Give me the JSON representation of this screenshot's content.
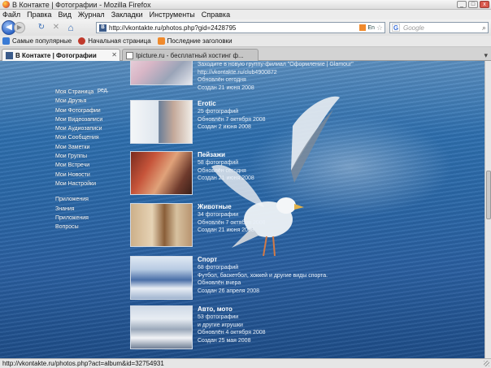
{
  "window": {
    "title": "В Контакте | Фотографии - Mozilla Firefox",
    "min_label": "_",
    "max_label": "□",
    "close_label": "x"
  },
  "menubar": [
    "Файл",
    "Правка",
    "Вид",
    "Журнал",
    "Закладки",
    "Инструменты",
    "Справка"
  ],
  "navbar": {
    "back_glyph": "◀",
    "forward_glyph": "▶",
    "reload_glyph": "↻",
    "stop_glyph": "✕",
    "home_glyph": "⌂",
    "favicon_label": "B",
    "url": "http://vkontakte.ru/photos.php?gid=2428795",
    "lang_label": "En",
    "star_glyph": "☆",
    "search_engine_label": "G",
    "search_placeholder": "Google",
    "search_glyph": "⌕"
  },
  "bookmarks": [
    {
      "label": "Самые популярные",
      "icon": "bookmark-check-icon",
      "color": "#3a7bd5"
    },
    {
      "label": "Начальная страница",
      "icon": "firefox-icon",
      "color": "#c0392b"
    },
    {
      "label": "Последние заголовки",
      "icon": "rss-icon",
      "color": "#f08a2c"
    }
  ],
  "tabs": [
    {
      "label": "В Контакте | Фотографии",
      "active": true,
      "close": "✕"
    },
    {
      "label": "Ipicture.ru - бесплатный хостинг ф...",
      "active": false,
      "close": ""
    }
  ],
  "tab_new_glyph": "▾",
  "left_menu": {
    "edit_label": "ред.",
    "items_main": [
      "Моя Страница",
      "Мои Друзья",
      "Мои Фотографии",
      "Мои Видеозаписи",
      "Мои Аудиозаписи",
      "Мои Сообщения",
      "Мои Заметки",
      "Мои Группы",
      "Мои Встречи",
      "Мои Новости",
      "Мои Настройки"
    ],
    "items_extra": [
      "Приложения",
      "Знания",
      "Приложения",
      "Вопросы"
    ]
  },
  "albums": [
    {
      "title": "",
      "lines": [
        "Заходите в новую группу-филиал \"Оформление | Glamour\"",
        "http://vkontakte.ru/club4900872",
        "Обновлён сегодня",
        "Создан 21 июня 2008"
      ]
    },
    {
      "title": "Erotic",
      "lines": [
        "25 фотографий",
        "Обновлён 7 октября 2008",
        "Создан 2 июня 2008"
      ]
    },
    {
      "title": "Пейзажи",
      "lines": [
        "58 фотографий",
        "Обновлён сегодня",
        "Создан 21 июня 2008"
      ]
    },
    {
      "title": "Животные",
      "lines": [
        "34 фотографии",
        "Обновлён 7 октября 2008",
        "Создан 21 июня 2008"
      ]
    },
    {
      "title": "Спорт",
      "lines": [
        "68 фотографий",
        "Футбол, баскетбол, хоккей и другие виды спорта.",
        "Обновлён вчера",
        "Создан 26 апреля 2008"
      ]
    },
    {
      "title": "Авто, мото",
      "lines": [
        "53 фотографии",
        "и другие игрушки",
        "Обновлён 4 октября 2008",
        "Создан 25 мая 2008"
      ]
    }
  ],
  "status": "http://vkontakte.ru/photos.php?act=album&id=32754931"
}
